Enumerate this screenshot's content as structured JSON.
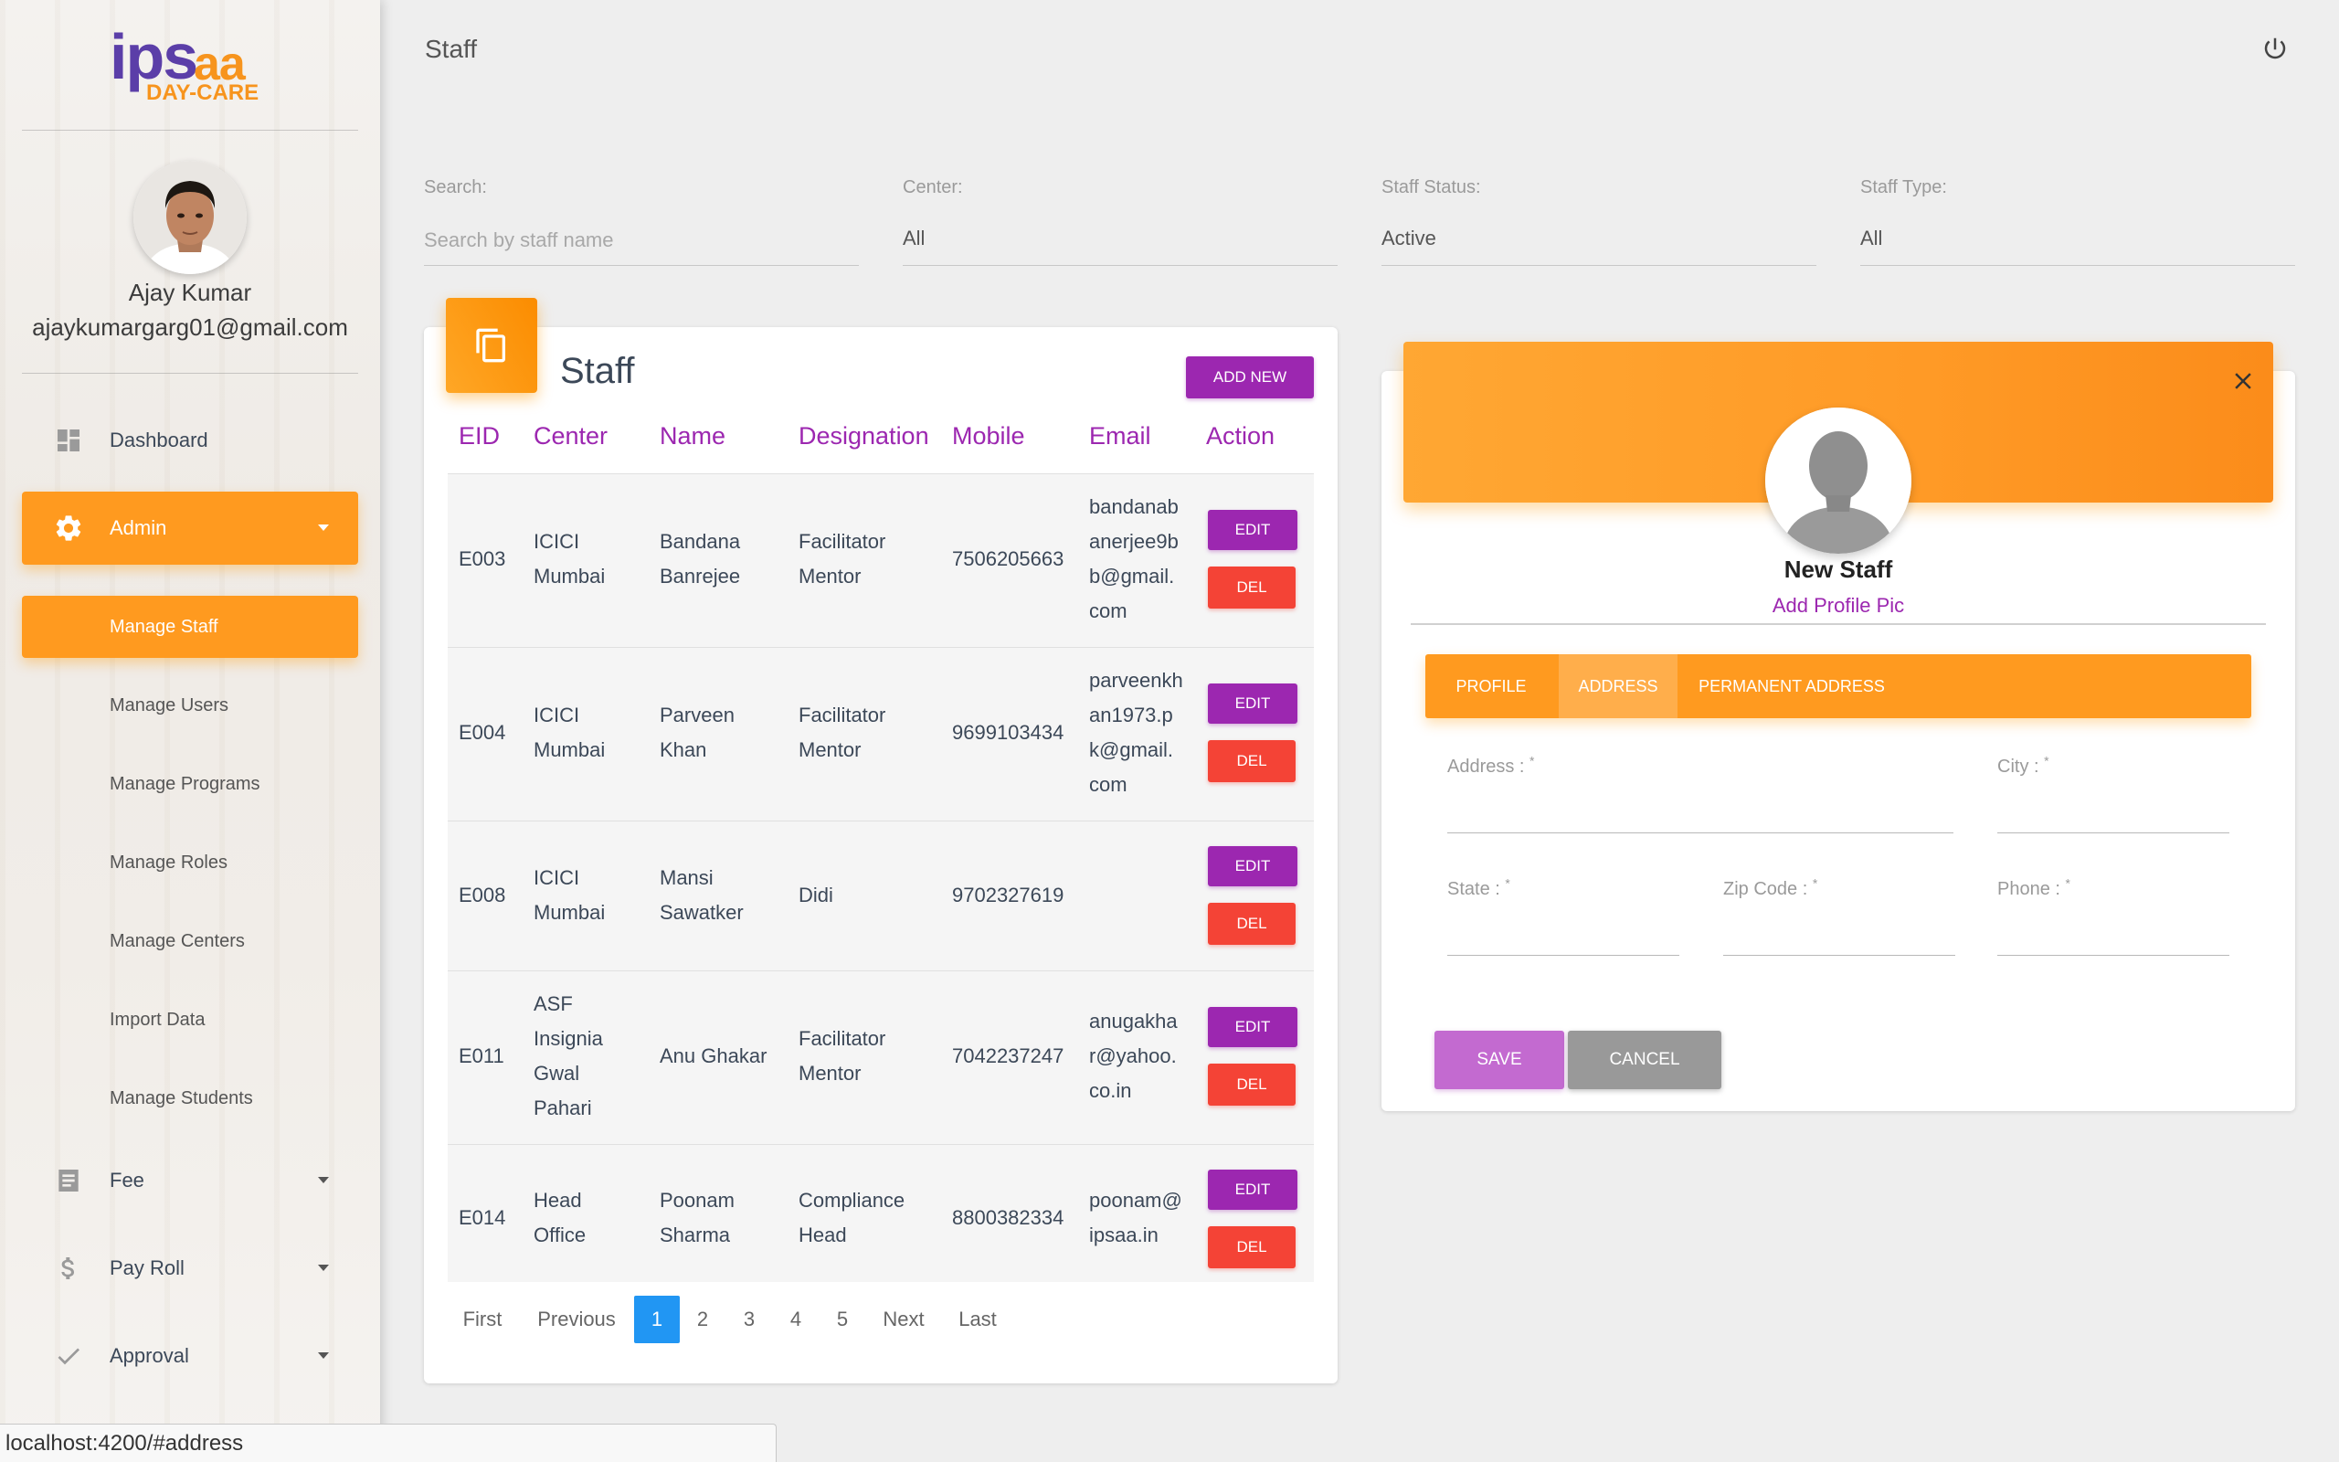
{
  "app": {
    "logo_main": "ips",
    "logo_accent": "aa",
    "logo_sub": "DAY-CARE"
  },
  "user": {
    "name": "Ajay Kumar",
    "email": "ajaykumargarg01@gmail.com"
  },
  "sidebar": {
    "items": [
      {
        "label": "Dashboard",
        "icon": "dashboard-icon"
      },
      {
        "label": "Admin",
        "icon": "gear-icon",
        "active": true
      },
      {
        "label": "Fee",
        "icon": "receipt-icon"
      },
      {
        "label": "Pay Roll",
        "icon": "dollar-icon"
      },
      {
        "label": "Approval",
        "icon": "check-icon"
      }
    ],
    "admin_subitems": [
      {
        "label": "Manage Staff",
        "active": true
      },
      {
        "label": "Manage Users"
      },
      {
        "label": "Manage Programs"
      },
      {
        "label": "Manage Roles"
      },
      {
        "label": "Manage Centers"
      },
      {
        "label": "Import Data"
      },
      {
        "label": "Manage Students"
      }
    ]
  },
  "header": {
    "title": "Staff",
    "power_icon": "power-icon"
  },
  "filters": {
    "search": {
      "label": "Search:",
      "placeholder": "Search by staff name"
    },
    "center": {
      "label": "Center:",
      "value": "All"
    },
    "status": {
      "label": "Staff Status:",
      "value": "Active"
    },
    "type": {
      "label": "Staff Type:",
      "value": "All"
    }
  },
  "staff_card": {
    "title": "Staff",
    "add_new": "ADD NEW",
    "columns": [
      "EID",
      "Center",
      "Name",
      "Designation",
      "Mobile",
      "Email",
      "Action"
    ],
    "edit_label": "EDIT",
    "del_label": "DEL",
    "rows": [
      {
        "eid": "E003",
        "center": [
          "ICICI",
          "Mumbai"
        ],
        "name": [
          "Bandana",
          "Banrejee"
        ],
        "designation": [
          "Facilitator",
          "Mentor"
        ],
        "mobile": "7506205663",
        "email": [
          "bandanab",
          "anerjee9b",
          "b@gmail.",
          "com"
        ]
      },
      {
        "eid": "E004",
        "center": [
          "ICICI",
          "Mumbai"
        ],
        "name": [
          "Parveen",
          "Khan"
        ],
        "designation": [
          "Facilitator",
          "Mentor"
        ],
        "mobile": "9699103434",
        "email": [
          "parveenkh",
          "an1973.p",
          "k@gmail.",
          "com"
        ]
      },
      {
        "eid": "E008",
        "center": [
          "ICICI",
          "Mumbai"
        ],
        "name": [
          "Mansi",
          "Sawatker"
        ],
        "designation": [
          "Didi"
        ],
        "mobile": "9702327619",
        "email": []
      },
      {
        "eid": "E011",
        "center": [
          "ASF",
          "Insignia",
          "Gwal",
          "Pahari"
        ],
        "name": [
          "Anu Ghakar"
        ],
        "designation": [
          "Facilitator",
          "Mentor"
        ],
        "mobile": "7042237247",
        "email": [
          "anugakha",
          "r@yahoo.",
          "co.in"
        ]
      },
      {
        "eid": "E014",
        "center": [
          "Head",
          "Office"
        ],
        "name": [
          "Poonam",
          "Sharma"
        ],
        "designation": [
          "Compliance",
          "Head"
        ],
        "mobile": "8800382334",
        "email": [
          "poonam@",
          "ipsaa.in"
        ]
      }
    ],
    "pagination": {
      "first": "First",
      "previous": "Previous",
      "pages": [
        "1",
        "2",
        "3",
        "4",
        "5"
      ],
      "current": "1",
      "next": "Next",
      "last": "Last"
    }
  },
  "profile_card": {
    "name": "New Staff",
    "add_pic": "Add Profile Pic",
    "tabs": [
      {
        "label": "PROFILE"
      },
      {
        "label": "ADDRESS",
        "active": true
      },
      {
        "label": "PERMANENT ADDRESS"
      }
    ],
    "fields": {
      "address": {
        "label": "Address :",
        "req": "*",
        "value": ""
      },
      "city": {
        "label": "City :",
        "req": "*",
        "value": ""
      },
      "state": {
        "label": "State :",
        "req": "*",
        "value": ""
      },
      "zip": {
        "label": "Zip Code :",
        "req": "*",
        "value": ""
      },
      "phone": {
        "label": "Phone :",
        "req": "*",
        "value": ""
      }
    },
    "save_label": "SAVE",
    "cancel_label": "CANCEL"
  },
  "status_bar": {
    "url": "localhost:4200/#address"
  },
  "colors": {
    "accent_orange": "#ff9a1f",
    "accent_purple": "#9c27b0",
    "danger_red": "#f44336",
    "page_active_blue": "#2196f3"
  }
}
